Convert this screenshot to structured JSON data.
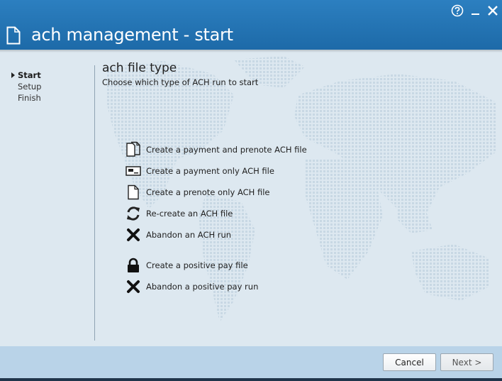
{
  "window": {
    "title": "ach management - start",
    "help_label": "?",
    "minimize_label": "minimize",
    "close_label": "close"
  },
  "steps": [
    {
      "label": "Start",
      "active": true
    },
    {
      "label": "Setup",
      "active": false
    },
    {
      "label": "Finish",
      "active": false
    }
  ],
  "section": {
    "title": "ach file type",
    "subtitle": "Choose which type of ACH run to start"
  },
  "options": [
    {
      "label": "Create a payment and prenote ACH file",
      "icon": "documents-icon"
    },
    {
      "label": "Create a payment only ACH file",
      "icon": "check-card-icon"
    },
    {
      "label": "Create a prenote only ACH file",
      "icon": "document-icon"
    },
    {
      "label": "Re-create an ACH file",
      "icon": "refresh-icon"
    },
    {
      "label": "Abandon an ACH run",
      "icon": "x-icon"
    },
    {
      "label": "Create a positive pay file",
      "icon": "lock-icon"
    },
    {
      "label": "Abandon a positive pay run",
      "icon": "x-icon"
    }
  ],
  "buttons": {
    "cancel": "Cancel",
    "next": "Next >"
  },
  "colors": {
    "header": "#1d6aa8",
    "body": "#dde8f0",
    "footer": "#b9d3e8"
  }
}
